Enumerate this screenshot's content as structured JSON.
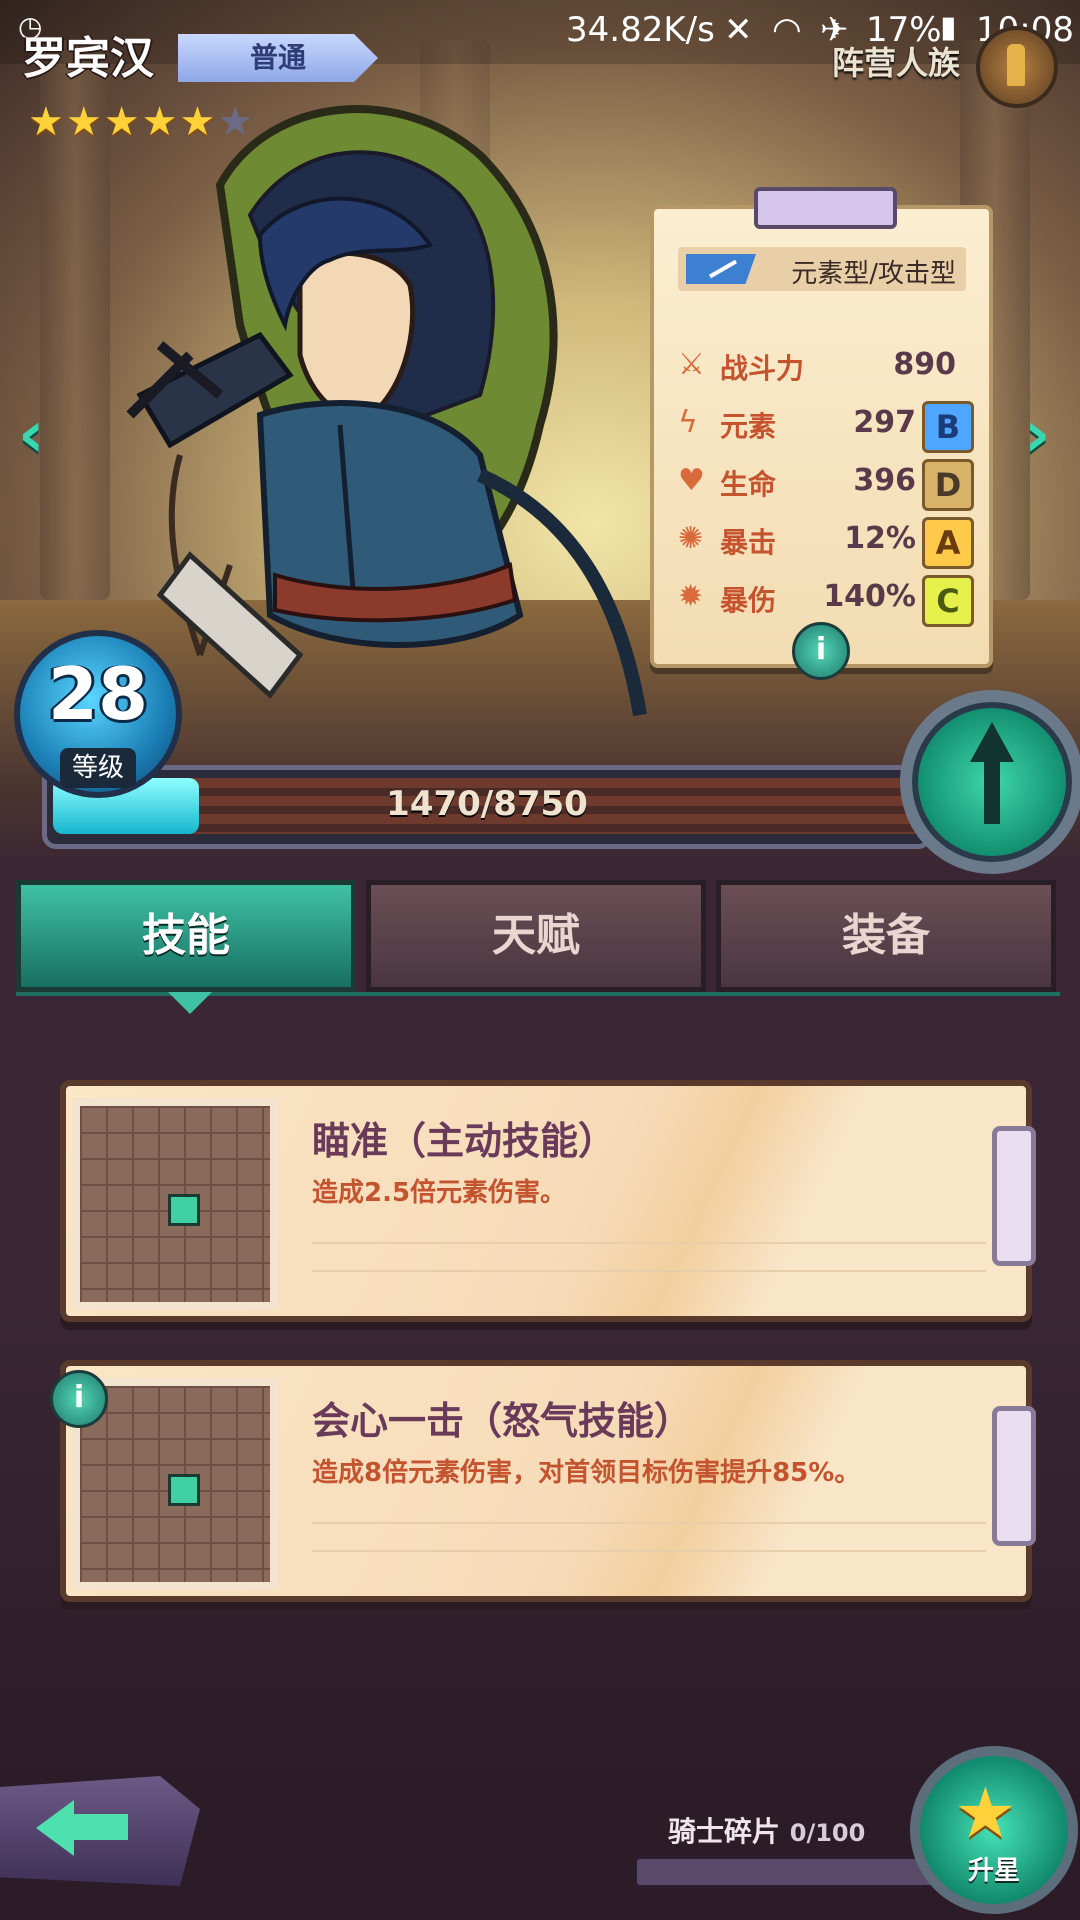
{
  "status_bar": {
    "speed": "34.82K/s",
    "battery": "17%",
    "time": "10:08"
  },
  "hero": {
    "name": "罗宾汉",
    "rarity": "普通",
    "faction": "阵营人族",
    "stars_filled": 5,
    "stars_total": 6,
    "level": "28",
    "level_label": "等级",
    "xp_text": "1470/8750",
    "xp_current": 1470,
    "xp_max": 8750
  },
  "stats_panel": {
    "type": "元素型/攻击型",
    "rows": [
      {
        "name": "战斗力",
        "value": "890",
        "grade": "",
        "icon": "power-icon"
      },
      {
        "name": "元素",
        "value": "297",
        "grade": "B",
        "icon": "lightning-icon"
      },
      {
        "name": "生命",
        "value": "396",
        "grade": "D",
        "icon": "heart-icon"
      },
      {
        "name": "暴击",
        "value": "12%",
        "grade": "A",
        "icon": "crit-icon"
      },
      {
        "name": "暴伤",
        "value": "140%",
        "grade": "C",
        "icon": "crit-damage-icon"
      }
    ]
  },
  "tabs": [
    {
      "label": "技能",
      "active": true
    },
    {
      "label": "天赋",
      "active": false
    },
    {
      "label": "装备",
      "active": false
    }
  ],
  "skills": [
    {
      "title": "瞄准（主动技能）",
      "desc": "造成2.5倍元素伤害。"
    },
    {
      "title": "会心一击（怒气技能）",
      "desc": "造成8倍元素伤害，对首领目标伤害提升85%。"
    }
  ],
  "footer": {
    "shards_label": "骑士碎片",
    "shards_count": "0/100",
    "shards_current": 0,
    "shards_max": 100,
    "starup_label": "升星"
  },
  "colors": {
    "accent": "#3fc1a4",
    "gold_star": "#ffd23a",
    "stat_name": "#c4532e"
  }
}
